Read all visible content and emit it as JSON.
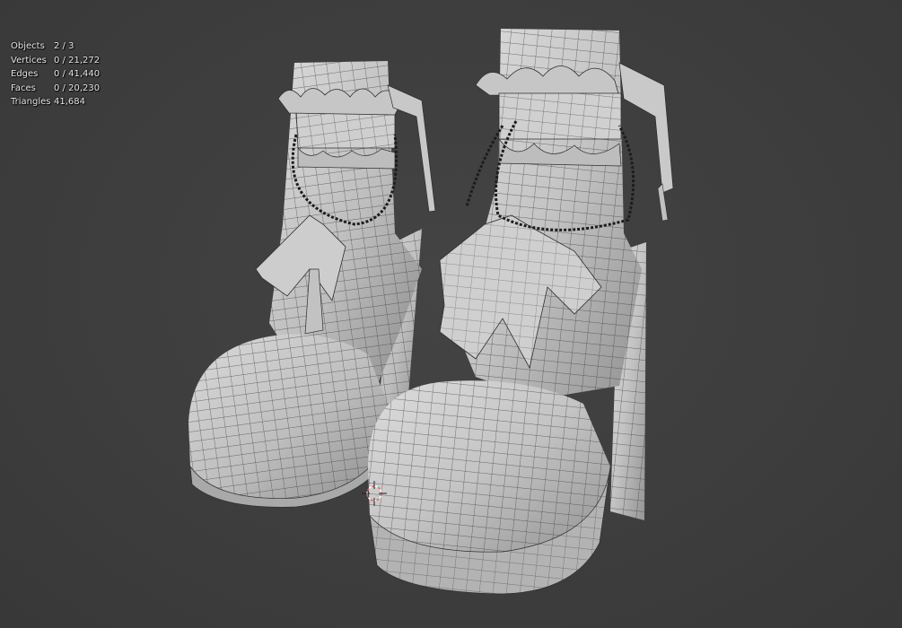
{
  "overlay": {
    "stats": [
      {
        "label": "Objects",
        "value": "2 / 3"
      },
      {
        "label": "Vertices",
        "value": "0 / 21,272"
      },
      {
        "label": "Edges",
        "value": "0 / 41,440"
      },
      {
        "label": "Faces",
        "value": "0 / 20,230"
      },
      {
        "label": "Triangles",
        "value": "41,684"
      }
    ]
  },
  "colors": {
    "background": "#3d3d3d",
    "mesh_light": "#d2d2d2",
    "mesh_dark": "#8e8e8e",
    "wire": "#2a2a2a",
    "chain": "#1c1c1c",
    "cursor": "#e06060"
  },
  "icons": [
    "3d-cursor-icon"
  ]
}
